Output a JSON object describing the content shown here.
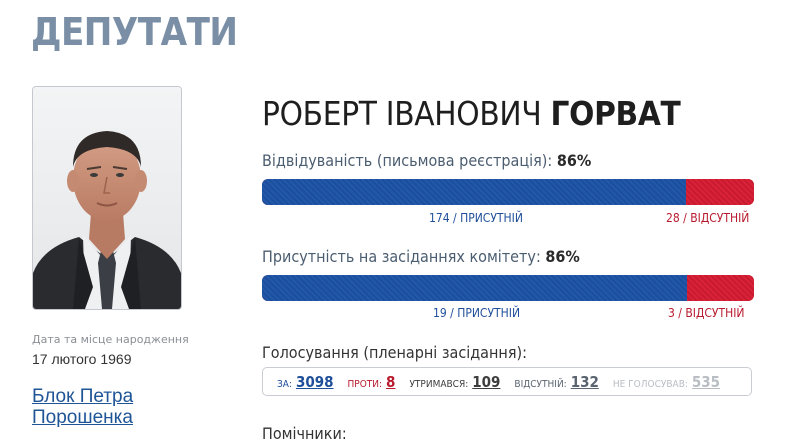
{
  "section_title": "ДЕПУТАТИ",
  "deputy": {
    "name_first": "РОБЕРТ ІВАНОВИЧ",
    "name_last": "ГОРВАТ",
    "birth_label": "Дата та місце народження",
    "birth_date": "17 лютого 1969",
    "faction": "Блок Петра Порошенка"
  },
  "attendance_written": {
    "label": "Відвідуваність (письмова реєстрація):",
    "percent": "86%",
    "present_fraction": 0.861,
    "present_caption": "174 / ПРИСУТНІЙ",
    "absent_caption": "28 / ВІДСУТНІЙ"
  },
  "attendance_committee": {
    "label": "Присутність на засіданнях комітету:",
    "percent": "86%",
    "present_fraction": 0.864,
    "present_caption": "19 / ПРИСУТНІЙ",
    "absent_caption": "3 / ВІДСУТНІЙ"
  },
  "voting": {
    "title": "Голосування (пленарні засідання):",
    "for_label": "ЗА:",
    "for_value": "3098",
    "against_label": "ПРОТИ:",
    "against_value": "8",
    "abstain_label": "УТРИМАВСЯ:",
    "abstain_value": "109",
    "absent_label": "ВІДСУТНІЙ:",
    "absent_value": "132",
    "novote_label": "НЕ ГОЛОСУВАВ:",
    "novote_value": "535"
  },
  "assistants_title": "Помічники:",
  "colors": {
    "present_blue": "#1f52a0",
    "absent_red": "#d21f35",
    "title_gray": "#7a8fa6",
    "link_blue": "#1f5597"
  }
}
